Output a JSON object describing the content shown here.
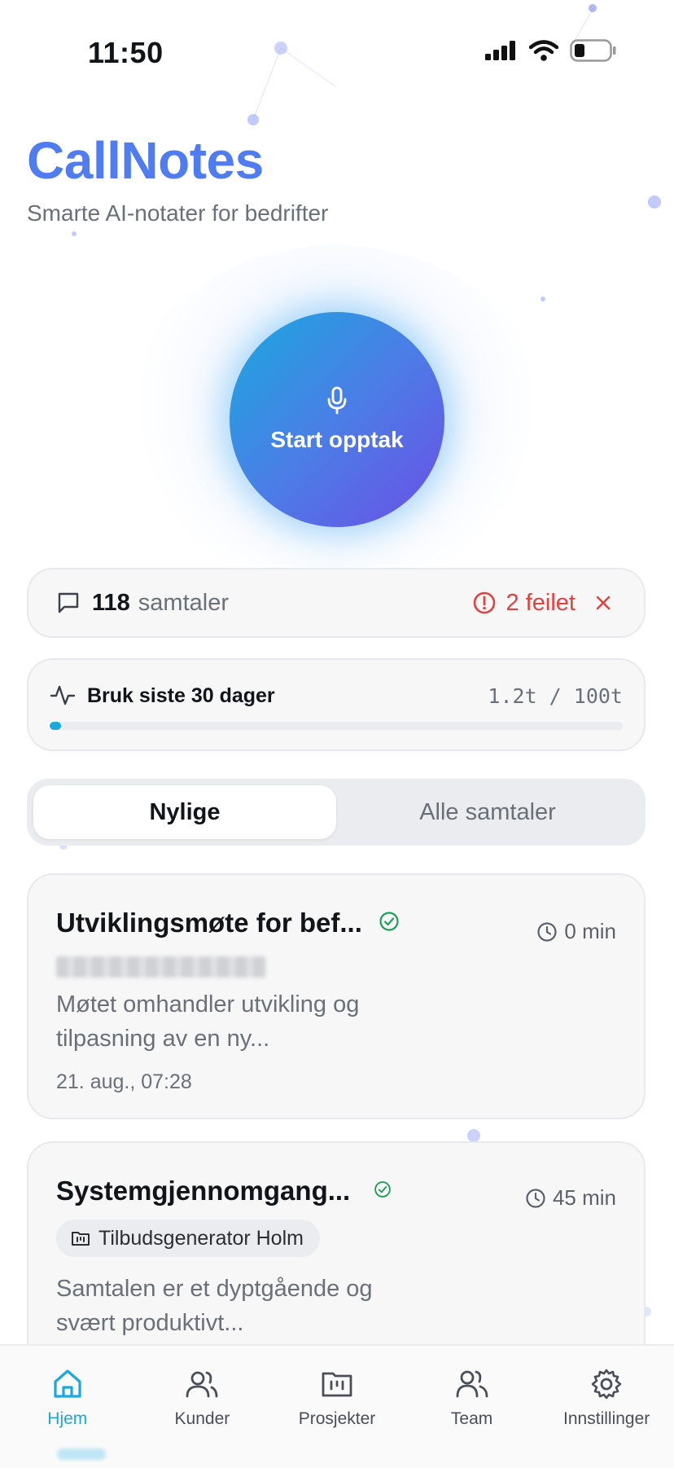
{
  "status_bar": {
    "time": "11:50"
  },
  "header": {
    "title": "CallNotes",
    "subtitle": "Smarte AI-notater for bedrifter"
  },
  "record": {
    "label": "Start opptak"
  },
  "stats": {
    "count": "118",
    "count_label": "samtaler",
    "failed": "2 feilet"
  },
  "usage": {
    "title": "Bruk siste 30 dager",
    "value": "1.2t / 100t",
    "fraction": 0.012
  },
  "tabs": [
    {
      "label": "Nylige",
      "active": true
    },
    {
      "label": "Alle samtaler",
      "active": false
    }
  ],
  "conversations": [
    {
      "title": "Utviklingsmøte for bef...",
      "duration": "0 min",
      "summary": "Møtet omhandler utvikling og tilpasning av en ny...",
      "date": "21. aug., 07:28"
    },
    {
      "title": "Systemgjennomgang...",
      "duration": "45 min",
      "project": "Tilbudsgenerator Holm",
      "summary": "Samtalen er et dyptgående og svært produktivt..."
    }
  ],
  "nav": [
    {
      "label": "Hjem",
      "icon": "home-icon",
      "active": true
    },
    {
      "label": "Kunder",
      "icon": "users-icon",
      "active": false
    },
    {
      "label": "Prosjekter",
      "icon": "folder-icon",
      "active": false
    },
    {
      "label": "Team",
      "icon": "team-icon",
      "active": false
    },
    {
      "label": "Innstillinger",
      "icon": "gear-icon",
      "active": false
    }
  ],
  "colors": {
    "brand": "#4f7cf0",
    "accent": "#1aa8de",
    "error": "#e2413c",
    "success": "#1e9e57"
  }
}
